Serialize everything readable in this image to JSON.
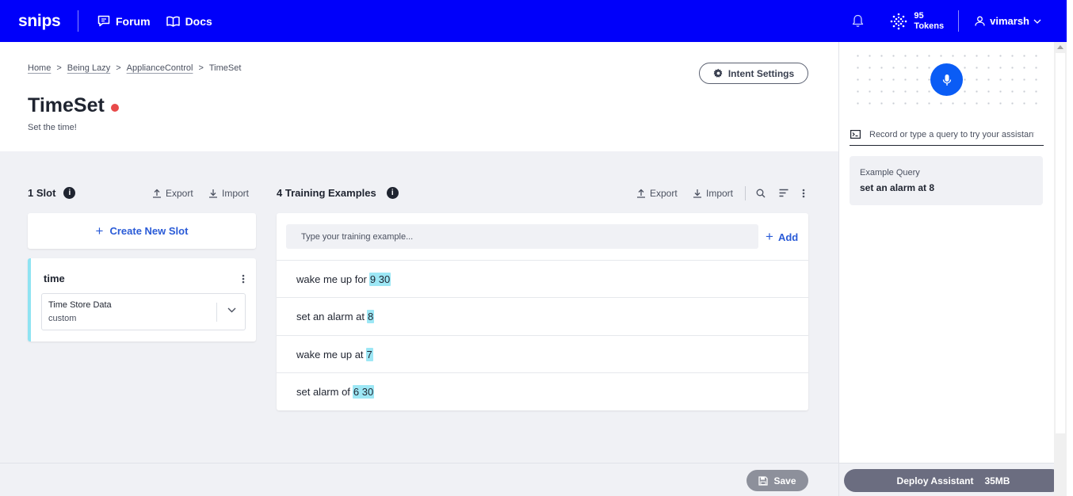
{
  "nav": {
    "logo": "snips",
    "forum": "Forum",
    "docs": "Docs",
    "tokens_count": "95",
    "tokens_label": "Tokens",
    "username": "vimarsh"
  },
  "breadcrumb": {
    "home": "Home",
    "sep": ">",
    "assistant": "Being Lazy",
    "app": "ApplianceControl",
    "current": "TimeSet"
  },
  "intent": {
    "title": "TimeSet",
    "subtitle": "Set the time!",
    "settings_label": "Intent Settings"
  },
  "slots": {
    "heading": "1 Slot",
    "export": "Export",
    "import": "Import",
    "create_label": "Create New Slot",
    "items": [
      {
        "name": "time",
        "type": "Time Store Data",
        "sub": "custom"
      }
    ]
  },
  "training": {
    "heading": "4 Training Examples",
    "export": "Export",
    "import": "Import",
    "placeholder": "Type your training example...",
    "add_label": "Add",
    "examples": [
      {
        "text": "wake me up for",
        "slot": "9 30"
      },
      {
        "text": "set an alarm at",
        "slot": "8"
      },
      {
        "text": "wake me up at",
        "slot": "7"
      },
      {
        "text": "set alarm of",
        "slot": "6 30"
      }
    ]
  },
  "footer": {
    "save_label": "Save"
  },
  "tester": {
    "placeholder": "Record or type a query to try your assistant",
    "example_label": "Example Query",
    "example_value": "set an alarm at 8",
    "deploy_label": "Deploy Assistant",
    "deploy_size": "35MB"
  },
  "colors": {
    "nav_bg": "#0000fa",
    "accent": "#2a5bd7",
    "status_dot": "#e84a4a",
    "slot_highlight": "#9de7f5"
  }
}
